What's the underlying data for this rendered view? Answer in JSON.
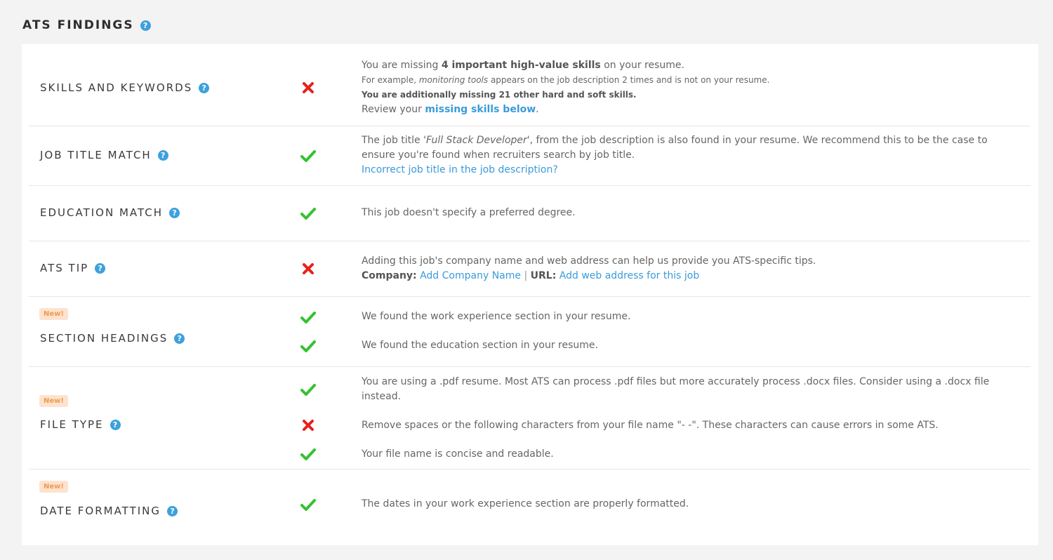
{
  "page_title": "ATS FINDINGS",
  "help_glyph": "?",
  "new_badge": "New!",
  "colors": {
    "check": "#34c232",
    "cross": "#e8201b",
    "link": "#3a9bd9",
    "badge_bg": "#fde3cf",
    "badge_text": "#ef9b4f"
  },
  "rows": [
    {
      "category": "SKILLS AND KEYWORDS",
      "status": "fail",
      "line1_pre": "You are missing ",
      "line1_bold": "4 important high-value skills",
      "line1_post": " on your resume.",
      "line2_pre": "For example, ",
      "line2_italic": "monitoring tools",
      "line2_post": " appears on the job description 2 times and is not on your resume.",
      "line3": "You are additionally missing 21 other hard and soft skills.",
      "line4_pre": "Review your ",
      "line4_link": "missing skills below",
      "line4_post": "."
    },
    {
      "category": "JOB TITLE MATCH",
      "status": "pass",
      "text_pre": "The job title ",
      "text_italic": "'Full Stack Developer'",
      "text_post": ", from the job description is also found in your resume. We recommend this to be the case to ensure you're found when recruiters search by job title.",
      "link": "Incorrect job title in the job description?"
    },
    {
      "category": "EDUCATION MATCH",
      "status": "pass",
      "text": "This job doesn't specify a preferred degree."
    },
    {
      "category": "ATS TIP",
      "status": "fail",
      "text": "Adding this job's company name and web address can help us provide you ATS-specific tips.",
      "company_label": "Company:",
      "company_link": "Add Company Name",
      "separator": "|",
      "url_label": "URL:",
      "url_link": "Add web address for this job"
    },
    {
      "category": "SECTION HEADINGS",
      "is_new": true,
      "findings": [
        {
          "status": "pass",
          "text": "We found the work experience section in your resume."
        },
        {
          "status": "pass",
          "text": "We found the education section in your resume."
        }
      ]
    },
    {
      "category": "FILE TYPE",
      "is_new": true,
      "findings": [
        {
          "status": "pass",
          "text": "You are using a .pdf resume. Most ATS can process .pdf files but more accurately process .docx files. Consider using a .docx file instead."
        },
        {
          "status": "fail",
          "text": "Remove spaces or the following characters from your file name \"- -\". These characters can cause errors in some ATS."
        },
        {
          "status": "pass",
          "text": "Your file name is concise and readable."
        }
      ]
    },
    {
      "category": "DATE FORMATTING",
      "is_new": true,
      "status": "pass",
      "text": "The dates in your work experience section are properly formatted."
    }
  ]
}
